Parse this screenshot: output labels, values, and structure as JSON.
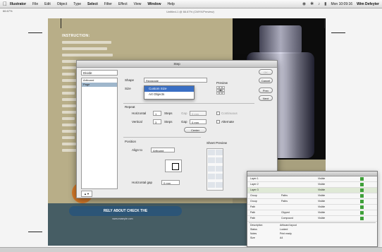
{
  "menubar": {
    "apple": "",
    "items": [
      "Illustrator",
      "File",
      "Edit",
      "Object",
      "Type",
      "Select",
      "Filter",
      "Effect",
      "View",
      "Window",
      "Help"
    ],
    "clock": "Mon 10:09:16",
    "user": "Wim Defeyter"
  },
  "document": {
    "title": "Untitled-1 @ 66.67% (CMYK/Preview)",
    "zoom": "66.67%"
  },
  "artwork": {
    "instruction_title": "INSTRUCTION:",
    "promo": "RELY ABOUT CHECK THE",
    "promo_url": "www.example.com"
  },
  "dialog": {
    "title": "Step",
    "panel_select": "Divide",
    "panel_list": [
      "Artboard",
      "Page"
    ],
    "panel_footer": "▲▼",
    "labels": {
      "shape": "Shape",
      "size": "Size",
      "preview": "Preview",
      "repeat": "Repeat",
      "horizontal": "Horizontal",
      "vertical": "Vertical",
      "steps": "Steps",
      "gap": "Gap",
      "position": "Position",
      "align_to": "Align to",
      "horizontal_gap": "Horizontal gap",
      "sheet_preview": "Sheet Preview",
      "continuous": "Continuous",
      "alternate": "Alternate"
    },
    "shape_value": "Rectangle",
    "size_value": "Custom Size",
    "size_options": [
      "Custom Size",
      "Art Objects"
    ],
    "horizontal_count": "1",
    "horizontal_steps": "Steps",
    "horizontal_gap": "0 mm",
    "vertical_count": "3",
    "vertical_steps": "Steps",
    "vertical_gap": "0 mm",
    "align_value": "Artboard",
    "hgap_value": "0 mm",
    "center_button": "Center",
    "ok_button": "OK",
    "cancel_button": "Cancel",
    "prev_button": "Prev",
    "next_button": "Next"
  },
  "layers": {
    "rows": [
      {
        "c1": "Layer 1",
        "c2": "",
        "c3": "Visible"
      },
      {
        "c1": "Layer 2",
        "c2": "",
        "c3": "Visible"
      },
      {
        "c1": "Layer 3",
        "c2": "",
        "c3": "Visible"
      },
      {
        "c1": "Group",
        "c2": "Paths",
        "c3": "Visible"
      },
      {
        "c1": "Group",
        "c2": "Paths",
        "c3": "Visible"
      },
      {
        "c1": "Path",
        "c2": "",
        "c3": "Visible"
      },
      {
        "c1": "Path",
        "c2": "Clipped",
        "c3": "Visible"
      },
      {
        "c1": "Path",
        "c2": "Compound",
        "c3": "Visible"
      }
    ],
    "info": [
      {
        "k": "Description",
        "v": "Artboard layout"
      },
      {
        "k": "Status",
        "v": "Locked"
      },
      {
        "k": "Notes",
        "v": "Print ready"
      },
      {
        "k": "Size",
        "v": "A4"
      }
    ]
  }
}
